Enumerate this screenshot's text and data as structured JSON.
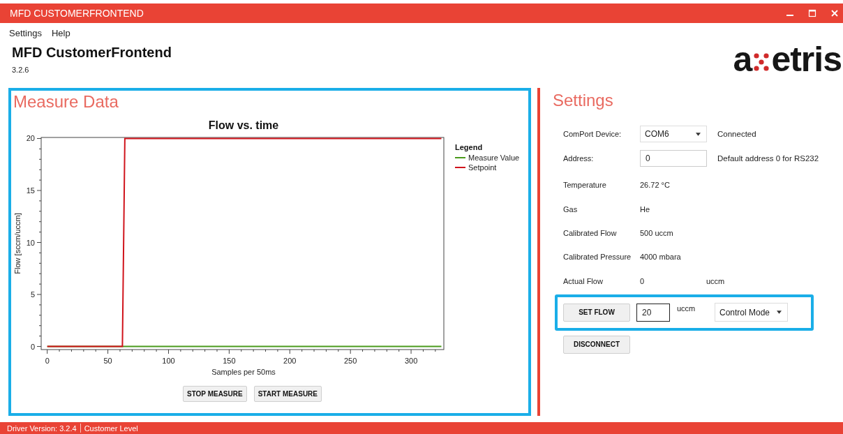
{
  "window": {
    "title": "MFD CUSTOMERFRONTEND"
  },
  "menu": [
    {
      "label": "Settings"
    },
    {
      "label": "Help"
    }
  ],
  "app": {
    "title": "MFD CustomerFrontend",
    "version": "3.2.6",
    "logo": {
      "before": "a",
      "after": "etris"
    }
  },
  "measure_panel": {
    "heading": "Measure Data",
    "highlighted": true,
    "chart_data": {
      "type": "line",
      "title": "Flow vs. time",
      "xlabel": "Samples per 50ms",
      "ylabel": "Flow [sccm/uccm]",
      "legend": {
        "title": "Legend"
      },
      "x": [
        0,
        62,
        64,
        325
      ],
      "series": [
        {
          "name": "Measure Value",
          "color": "#4a9a1c",
          "values": [
            0,
            0,
            0,
            0
          ]
        },
        {
          "name": "Setpoint",
          "color": "#d0141c",
          "values": [
            0,
            0,
            20,
            20
          ]
        }
      ],
      "xlim": [
        -5,
        327
      ],
      "ylim": [
        -0.3,
        20.1
      ],
      "xticks": [
        0,
        50,
        100,
        150,
        200,
        250,
        300
      ],
      "yticks": [
        0,
        5,
        10,
        15,
        20
      ]
    },
    "buttons": [
      {
        "label": "STOP MEASURE"
      },
      {
        "label": "START MEASURE"
      }
    ]
  },
  "settings_panel": {
    "heading": "Settings",
    "comport": {
      "label": "ComPort Device:",
      "value": "COM6",
      "status": "Connected"
    },
    "address": {
      "label": "Address:",
      "value": "0",
      "hint": "Default address 0 for RS232"
    },
    "readings": [
      {
        "label": "Temperature",
        "value": "26.72 °C"
      },
      {
        "label": "Gas",
        "value": "He"
      },
      {
        "label": "Calibrated Flow",
        "value": "500 uccm"
      },
      {
        "label": "Calibrated Pressure",
        "value": "4000 mbara"
      },
      {
        "label": "Actual Flow",
        "value": "0",
        "unit": "uccm"
      }
    ],
    "set_flow": {
      "highlighted": true,
      "button": "SET FLOW",
      "value": "20",
      "unit": "uccm",
      "mode": "Control Mode"
    },
    "disconnect": "DISCONNECT"
  },
  "status_bar": [
    {
      "text": "Driver Version: 3.2.4"
    },
    {
      "text": "Customer Level"
    }
  ]
}
